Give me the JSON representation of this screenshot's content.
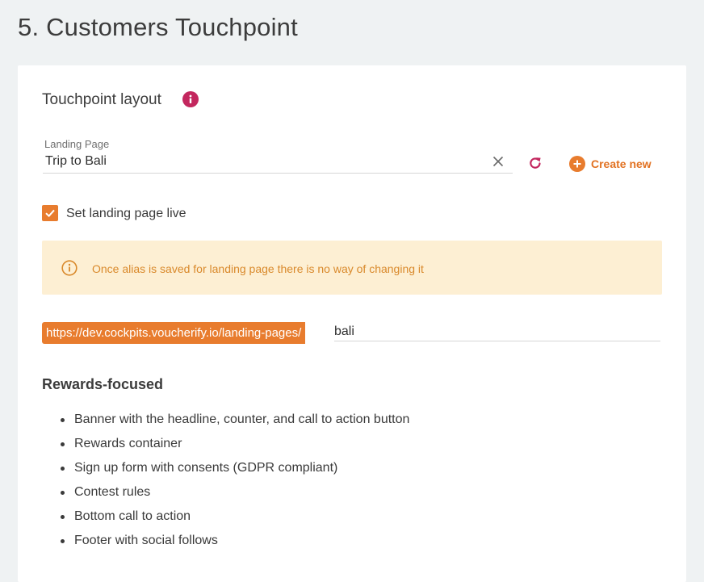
{
  "page": {
    "title": "5. Customers Touchpoint"
  },
  "touchpoint": {
    "section_title": "Touchpoint layout",
    "info_icon": "info-icon",
    "landing_page": {
      "label": "Landing Page",
      "value": "Trip to Bali",
      "clear_icon": "close-icon",
      "refresh_icon": "refresh-icon"
    },
    "create_new": {
      "label": "Create new",
      "icon": "plus-circle-icon"
    },
    "live_checkbox": {
      "label": "Set landing page live",
      "checked": true
    },
    "alert": {
      "icon": "info-circle-icon",
      "text": "Once alias is saved for landing page there is no way of changing it"
    },
    "url": {
      "prefix": "https://dev.cockpits.voucherify.io/landing-pages/",
      "alias": "bali"
    }
  },
  "rewards": {
    "title": "Rewards-focused",
    "items": [
      "Banner with the headline, counter, and call to action button",
      "Rewards container",
      "Sign up form with consents (GDPR compliant)",
      "Contest rules",
      "Bottom call to action",
      "Footer with social follows"
    ]
  },
  "colors": {
    "accent": "#e87c2e",
    "info_badge": "#c3275e",
    "alert_bg": "#fdefd3",
    "alert_text": "#d9892b",
    "page_bg": "#eff2f3"
  }
}
